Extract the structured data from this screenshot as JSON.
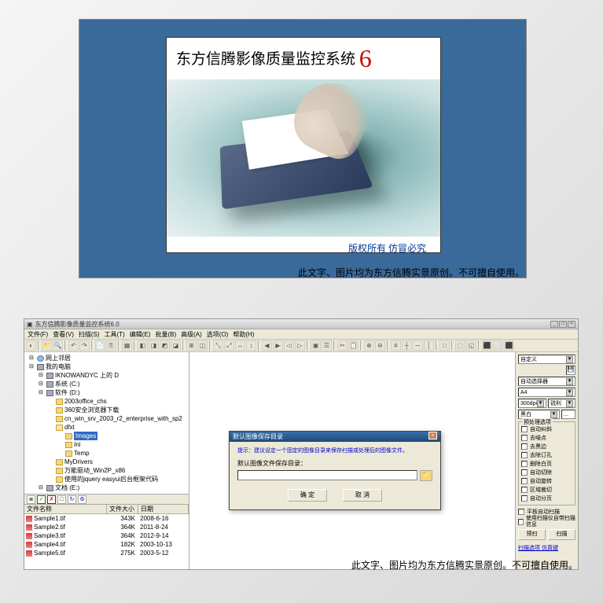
{
  "splash": {
    "title_text": "东方信腾影像质量监控系统",
    "version": "6",
    "footer": "版权所有  仿冒必究"
  },
  "caption": "此文字、图片均为东方信腾实景原创。不可擅自使用。",
  "app": {
    "title": "东方信腾影像质量监控系统6.0",
    "menu": [
      "文件(F)",
      "查看(V)",
      "扫描(S)",
      "工具(T)",
      "编辑(E)",
      "批量(B)",
      "高级(A)",
      "选项(O)",
      "帮助(H)"
    ],
    "tree": [
      {
        "indent": 0,
        "icon": "net",
        "label": "网上邻居"
      },
      {
        "indent": 0,
        "icon": "drive",
        "label": "我的电脑"
      },
      {
        "indent": 1,
        "icon": "drive",
        "label": "IKNOWANDYC 上的 D"
      },
      {
        "indent": 1,
        "icon": "drive",
        "label": "系统 (C:)"
      },
      {
        "indent": 1,
        "icon": "drive",
        "label": "软件 (D:)"
      },
      {
        "indent": 2,
        "icon": "folder",
        "label": "2003office_chs"
      },
      {
        "indent": 2,
        "icon": "folder",
        "label": "360安全浏览器下载"
      },
      {
        "indent": 2,
        "icon": "folder",
        "label": "cn_win_srv_2003_r2_enterprise_with_sp2"
      },
      {
        "indent": 2,
        "icon": "folder-open",
        "label": "dfxt"
      },
      {
        "indent": 3,
        "icon": "folder",
        "label": "Images",
        "sel": true
      },
      {
        "indent": 3,
        "icon": "folder",
        "label": "Ini"
      },
      {
        "indent": 3,
        "icon": "folder",
        "label": "Temp"
      },
      {
        "indent": 2,
        "icon": "folder",
        "label": "MyDrivers"
      },
      {
        "indent": 2,
        "icon": "folder",
        "label": "万能驱动_Win2P_x86"
      },
      {
        "indent": 2,
        "icon": "folder",
        "label": "使用的jquery easyui后台框架代码"
      },
      {
        "indent": 1,
        "icon": "drive",
        "label": "文档 (E:)"
      }
    ],
    "file_header": [
      "文件名称",
      "文件大小",
      "日期"
    ],
    "files": [
      {
        "name": "Sample1.tif",
        "size": "343K",
        "date": "2008-6-16"
      },
      {
        "name": "Sample2.tif",
        "size": "364K",
        "date": "2011-8-24"
      },
      {
        "name": "Sample3.tif",
        "size": "364K",
        "date": "2012-9-14"
      },
      {
        "name": "Sample4.tif",
        "size": "182K",
        "date": "2003-10-13"
      },
      {
        "name": "Sample5.tif",
        "size": "275K",
        "date": "2003-5-12"
      }
    ],
    "dialog": {
      "title": "默认图像保存目录",
      "hint": "提示：建议设定一个固定的图像目录来保存扫描或处理后的图像文件。",
      "label": "默认图像文件保存目录：",
      "ok": "确 定",
      "cancel": "取 消"
    },
    "right": {
      "sel1": "自定义",
      "sel2": "自动选择器",
      "sel3": "A4",
      "sel4": "300dpi",
      "sel5": "锐利",
      "sel6": "黑白",
      "group_title": "预处理选项",
      "checks": [
        "自动纠斜",
        "去噪点",
        "去黑边",
        "去除订孔",
        "删除白页",
        "自动切除",
        "自动旋转",
        "区域裁切",
        "自动分页"
      ],
      "check_a": "平板自动扫描",
      "check_b": "使用扫描仪自带扫描信息",
      "btn1": "预扫",
      "btn2": "扫描",
      "links": "扫描选项 仿真键"
    }
  }
}
